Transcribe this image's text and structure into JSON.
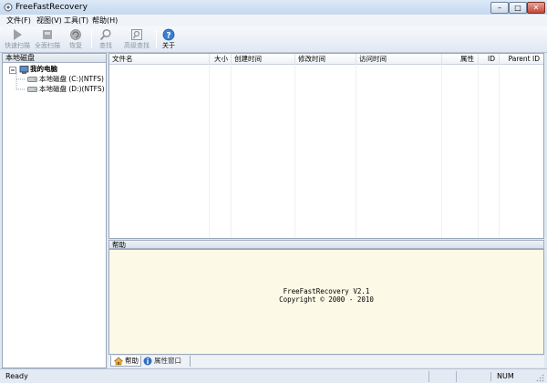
{
  "window": {
    "title": "FreeFastRecovery",
    "minimize": "–",
    "maximize": "□",
    "close": "✕"
  },
  "menu": [
    "文件(F)",
    "视图(V)",
    "工具(T)",
    "帮助(H)"
  ],
  "toolbar": {
    "quick_scan": "快速扫描",
    "full_scan": "全面扫描",
    "recover": "恢复",
    "find": "查找",
    "advanced_find": "高级查找",
    "about": "关于"
  },
  "left_panel": {
    "title": "本地磁盘",
    "tree_root": "我的电脑",
    "drives": [
      "本地磁盘 (C:)(NTFS)",
      "本地磁盘 (D:)(NTFS)"
    ]
  },
  "list": {
    "columns": [
      "文件名",
      "大小",
      "创建时间",
      "修改时间",
      "访问时间",
      "属性",
      "ID",
      "Parent ID"
    ]
  },
  "help": {
    "title": "帮助",
    "line1": "FreeFastRecovery V2.1",
    "line2": "Copyright ©  2000 - 2010"
  },
  "tabs": {
    "help": "帮助",
    "properties": "属性窗口"
  },
  "status": {
    "ready": "Ready",
    "num": "NUM"
  },
  "icons": {
    "app": "app-icon",
    "tree_expand": "minus-box-icon"
  }
}
